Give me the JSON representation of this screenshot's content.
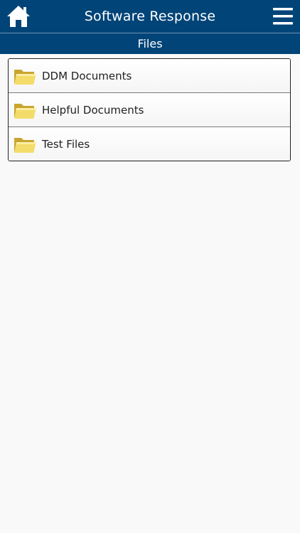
{
  "header": {
    "title": "Software Response",
    "home_icon": "home-icon",
    "menu_icon": "hamburger-menu-icon",
    "background": "#004478"
  },
  "subheader": {
    "title": "Files"
  },
  "files": {
    "items": [
      {
        "label": "DDM Documents",
        "icon": "folder-icon"
      },
      {
        "label": "Helpful Documents",
        "icon": "folder-icon"
      },
      {
        "label": "Test Files",
        "icon": "folder-icon"
      }
    ]
  }
}
